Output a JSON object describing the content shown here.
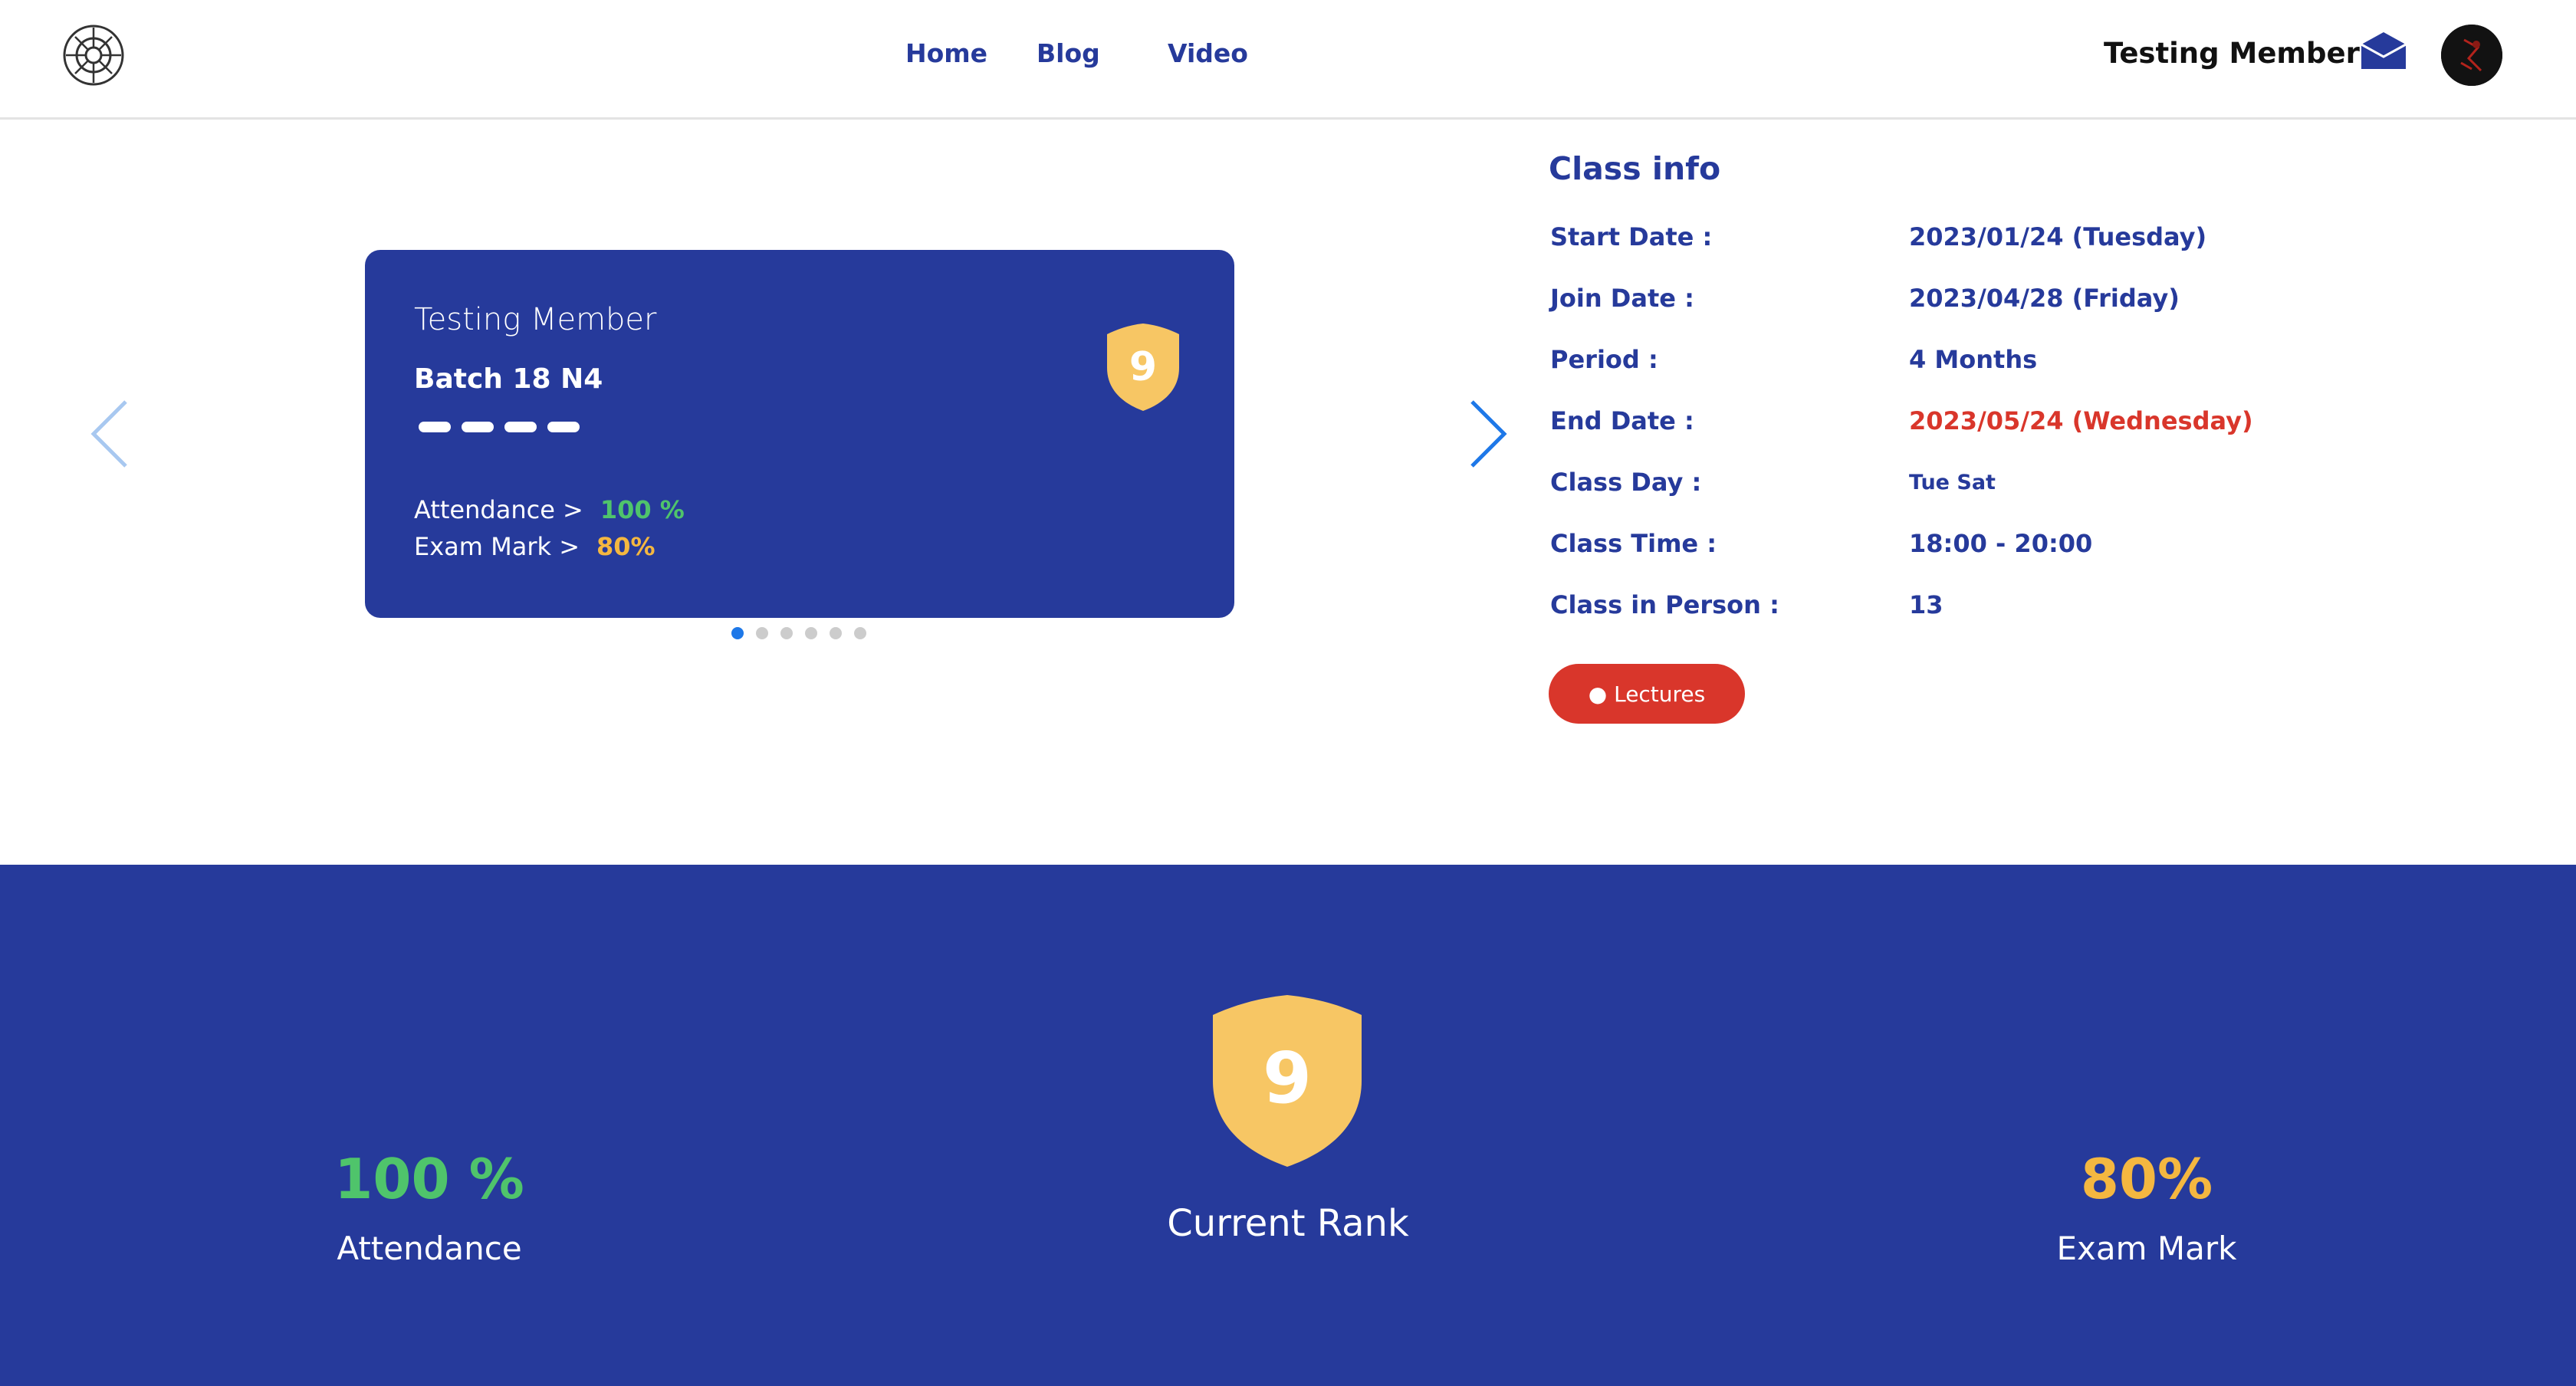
{
  "header": {
    "nav": [
      {
        "label": "Home"
      },
      {
        "label": "Blog"
      },
      {
        "label": "Video"
      }
    ],
    "user_name": "Testing Member",
    "icons": {
      "logo": "logo-icon",
      "mail": "mail-icon",
      "avatar": "avatar"
    }
  },
  "card": {
    "name": "Testing Member",
    "batch": "Batch 18 N4",
    "rank": "9",
    "attendance_label": "Attendance >",
    "attendance_value": "100 %",
    "exam_label": "Exam Mark >",
    "exam_value": "80%",
    "slides_total": 6,
    "active_slide": 1
  },
  "class_info": {
    "title": "Class info",
    "rows": [
      {
        "label": "Start Date :",
        "value": "2023/01/24 (Tuesday)"
      },
      {
        "label": "Join Date :",
        "value": "2023/04/28 (Friday)"
      },
      {
        "label": "Period :",
        "value": "4 Months"
      },
      {
        "label": "End Date :",
        "value": "2023/05/24 (Wednesday)"
      },
      {
        "label": "Class Day :",
        "value": "Tue Sat"
      },
      {
        "label": "Class Time :",
        "value": "18:00 - 20:00"
      },
      {
        "label": "Class in Person :",
        "value": "13"
      }
    ],
    "lectures_button": "● Lectures"
  },
  "stats": {
    "attendance_value": "100 %",
    "attendance_label": "Attendance",
    "rank_value": "9",
    "rank_label": "Current Rank",
    "exam_value": "80%",
    "exam_label": "Exam Mark"
  },
  "colors": {
    "primary": "#263a9b",
    "green": "#4fc46b",
    "yellow": "#f4b740",
    "red": "#d9362b",
    "shield": "#f7c664"
  }
}
